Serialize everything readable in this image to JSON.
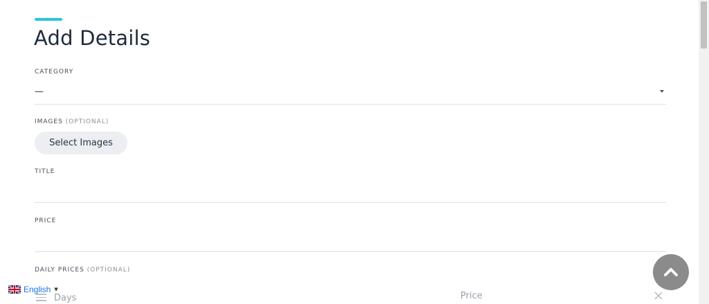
{
  "form": {
    "title": "Add Details",
    "category": {
      "label": "CATEGORY",
      "value": "—"
    },
    "images": {
      "label": "IMAGES",
      "optional_label": "(OPTIONAL)",
      "button_label": "Select Images"
    },
    "title_field": {
      "label": "TITLE",
      "value": ""
    },
    "price_field": {
      "label": "PRICE",
      "value": ""
    },
    "daily_prices": {
      "label": "DAILY PRICES",
      "optional_label": "(OPTIONAL)",
      "row": {
        "days_placeholder": "Days",
        "price_placeholder": "Price"
      }
    }
  },
  "language": {
    "label": "English"
  },
  "colors": {
    "accent": "#29c5dc",
    "link": "#1a73e8",
    "scroll_button": "#8b8b8b",
    "button_bg": "#eceef2"
  },
  "icons": {
    "drag": "drag-handle-icon",
    "remove": "close-icon",
    "scroll_top": "chevron-up-icon",
    "flag": "uk-flag-icon"
  }
}
